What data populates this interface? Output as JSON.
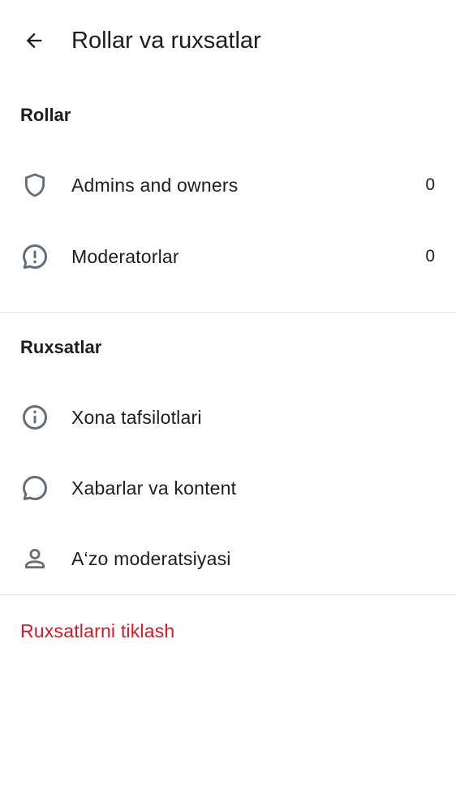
{
  "header": {
    "title": "Rollar va ruxsatlar",
    "back_icon": "arrow-left-icon"
  },
  "roles_section": {
    "title": "Rollar",
    "items": [
      {
        "label": "Admins and owners",
        "count": "0",
        "icon": "shield-icon"
      },
      {
        "label": "Moderatorlar",
        "count": "0",
        "icon": "chat-alert-icon"
      }
    ]
  },
  "permissions_section": {
    "title": "Ruxsatlar",
    "items": [
      {
        "label": "Xona tafsilotlari",
        "icon": "info-icon"
      },
      {
        "label": "Xabarlar va kontent",
        "icon": "chat-bubble-icon"
      },
      {
        "label": "A‘zo moderatsiyasi",
        "icon": "user-icon"
      }
    ]
  },
  "reset": {
    "label": "Ruxsatlarni tiklash"
  },
  "colors": {
    "text": "#1b1d21",
    "icon": "#656d77",
    "danger": "#d51928",
    "divider": "#e3e5e8"
  }
}
